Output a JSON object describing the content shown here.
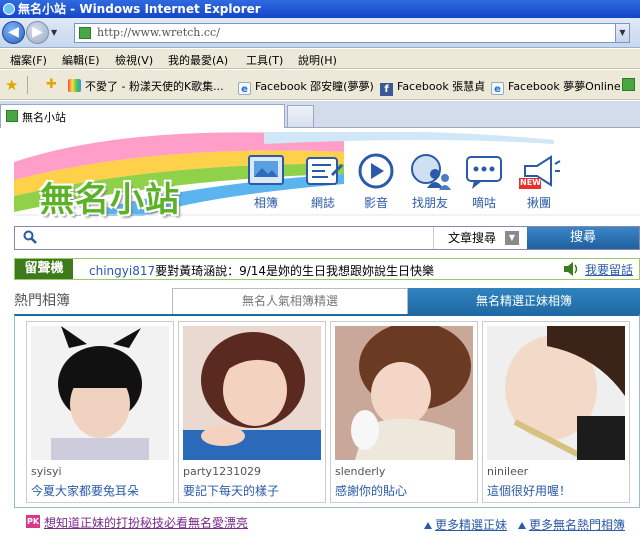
{
  "window": {
    "title": "無名小站 - Windows Internet Explorer"
  },
  "address": {
    "url": "http://www.wretch.cc/"
  },
  "menu": [
    "檔案(F)",
    "編輯(E)",
    "檢視(V)",
    "我的最愛(A)",
    "工具(T)",
    "說明(H)"
  ],
  "favorites": [
    {
      "label": "不愛了 - 粉漾天使的K歌集...",
      "icon": "rainbow-site-icon"
    },
    {
      "label": "Facebook 邵安瞳(夢夢)",
      "icon": "ie-page-icon"
    },
    {
      "label": "Facebook 張慧貞",
      "icon": "facebook-icon"
    },
    {
      "label": "Facebook 夢夢Online",
      "icon": "ie-page-icon"
    }
  ],
  "tab": {
    "label": "無名小站"
  },
  "site": {
    "logo": "無名小站",
    "nav": [
      {
        "label": "相簿",
        "icon": "album-icon"
      },
      {
        "label": "網誌",
        "icon": "blog-icon"
      },
      {
        "label": "影音",
        "icon": "video-play-icon"
      },
      {
        "label": "找朋友",
        "icon": "find-friends-icon"
      },
      {
        "label": "嘀咕",
        "icon": "chat-bubble-icon"
      },
      {
        "label": "揪團",
        "icon": "megaphone-new-icon",
        "badge": "NEW"
      }
    ],
    "search": {
      "scope": "文章搜尋",
      "button": "搜尋"
    },
    "shoutbox": {
      "tag": "留聲機",
      "user": "chingyi817",
      "message": "要對黃琦涵說：9/14是妳的生日我想跟妳說生日快樂",
      "link": "我要留話"
    },
    "albums": {
      "heading": "熱門相簿",
      "tabs": [
        "無名人氣相簿精選",
        "無名精選正妹相簿"
      ],
      "cards": [
        {
          "user": "syisyi",
          "title": "今夏大家都要兔耳朵"
        },
        {
          "user": "party1231029",
          "title": "要記下每天的樣子"
        },
        {
          "user": "slenderly",
          "title": "感謝你的貼心"
        },
        {
          "user": "ninileer",
          "title": "這個很好用喔！"
        }
      ],
      "promo": {
        "badge": "PK",
        "text": "想知道正妹的打扮秘技必看無名愛漂亮"
      },
      "more": [
        "更多精選正妹",
        "更多無名熱門相簿"
      ]
    }
  },
  "colors": {
    "accent": "#1f6aa5",
    "link": "#2a5aa8",
    "logo": "#5bb227",
    "shout": "#3d7a1c"
  }
}
